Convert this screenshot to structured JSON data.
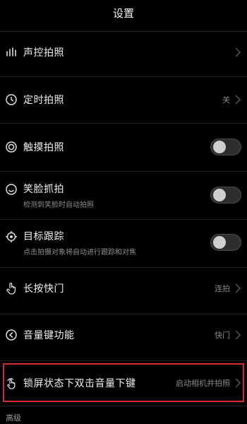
{
  "header": {
    "title": "设置"
  },
  "items": [
    {
      "id": "voice",
      "icon": "sound-bars-icon",
      "title": "声控拍照",
      "control": "chevron"
    },
    {
      "id": "timer",
      "icon": "clock-icon",
      "title": "定时拍照",
      "value": "关",
      "control": "chevron"
    },
    {
      "id": "touch",
      "icon": "touch-circle-icon",
      "title": "触摸拍照",
      "control": "toggle",
      "on": false
    },
    {
      "id": "smile",
      "icon": "smile-icon",
      "title": "笑脸抓拍",
      "subtitle": "检测到笑脸时自动拍照",
      "control": "toggle",
      "on": false
    },
    {
      "id": "track",
      "icon": "target-icon",
      "title": "目标跟踪",
      "subtitle": "点击拍摄对象将自动进行跟踪和对焦",
      "control": "toggle",
      "on": false
    },
    {
      "id": "longpress",
      "icon": "hand-press-icon",
      "title": "长按快门",
      "value": "连拍",
      "control": "chevron"
    },
    {
      "id": "volume",
      "icon": "volume-icon",
      "title": "音量键功能",
      "value": "快门",
      "control": "chevron"
    },
    {
      "id": "lockscreen",
      "icon": "double-tap-icon",
      "title": "锁屏状态下双击音量下键",
      "value": "启动相机并拍照",
      "control": "chevron"
    }
  ],
  "section": {
    "title": "高级"
  },
  "colors": {
    "background": "#000000",
    "highlight": "#d32b2b",
    "knob": "#cfcfcf"
  }
}
